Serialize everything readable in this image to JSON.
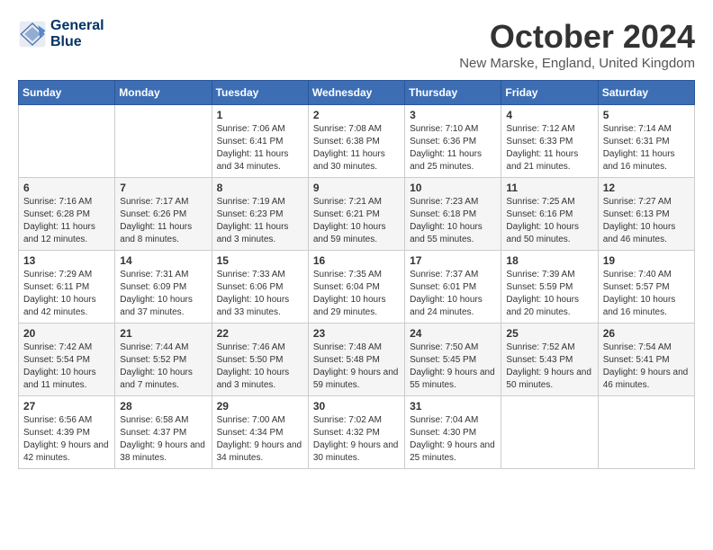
{
  "header": {
    "logo_line1": "General",
    "logo_line2": "Blue",
    "month_title": "October 2024",
    "location": "New Marske, England, United Kingdom"
  },
  "days_of_week": [
    "Sunday",
    "Monday",
    "Tuesday",
    "Wednesday",
    "Thursday",
    "Friday",
    "Saturday"
  ],
  "weeks": [
    [
      {
        "day": "",
        "sunrise": "",
        "sunset": "",
        "daylight": ""
      },
      {
        "day": "",
        "sunrise": "",
        "sunset": "",
        "daylight": ""
      },
      {
        "day": "1",
        "sunrise": "Sunrise: 7:06 AM",
        "sunset": "Sunset: 6:41 PM",
        "daylight": "Daylight: 11 hours and 34 minutes."
      },
      {
        "day": "2",
        "sunrise": "Sunrise: 7:08 AM",
        "sunset": "Sunset: 6:38 PM",
        "daylight": "Daylight: 11 hours and 30 minutes."
      },
      {
        "day": "3",
        "sunrise": "Sunrise: 7:10 AM",
        "sunset": "Sunset: 6:36 PM",
        "daylight": "Daylight: 11 hours and 25 minutes."
      },
      {
        "day": "4",
        "sunrise": "Sunrise: 7:12 AM",
        "sunset": "Sunset: 6:33 PM",
        "daylight": "Daylight: 11 hours and 21 minutes."
      },
      {
        "day": "5",
        "sunrise": "Sunrise: 7:14 AM",
        "sunset": "Sunset: 6:31 PM",
        "daylight": "Daylight: 11 hours and 16 minutes."
      }
    ],
    [
      {
        "day": "6",
        "sunrise": "Sunrise: 7:16 AM",
        "sunset": "Sunset: 6:28 PM",
        "daylight": "Daylight: 11 hours and 12 minutes."
      },
      {
        "day": "7",
        "sunrise": "Sunrise: 7:17 AM",
        "sunset": "Sunset: 6:26 PM",
        "daylight": "Daylight: 11 hours and 8 minutes."
      },
      {
        "day": "8",
        "sunrise": "Sunrise: 7:19 AM",
        "sunset": "Sunset: 6:23 PM",
        "daylight": "Daylight: 11 hours and 3 minutes."
      },
      {
        "day": "9",
        "sunrise": "Sunrise: 7:21 AM",
        "sunset": "Sunset: 6:21 PM",
        "daylight": "Daylight: 10 hours and 59 minutes."
      },
      {
        "day": "10",
        "sunrise": "Sunrise: 7:23 AM",
        "sunset": "Sunset: 6:18 PM",
        "daylight": "Daylight: 10 hours and 55 minutes."
      },
      {
        "day": "11",
        "sunrise": "Sunrise: 7:25 AM",
        "sunset": "Sunset: 6:16 PM",
        "daylight": "Daylight: 10 hours and 50 minutes."
      },
      {
        "day": "12",
        "sunrise": "Sunrise: 7:27 AM",
        "sunset": "Sunset: 6:13 PM",
        "daylight": "Daylight: 10 hours and 46 minutes."
      }
    ],
    [
      {
        "day": "13",
        "sunrise": "Sunrise: 7:29 AM",
        "sunset": "Sunset: 6:11 PM",
        "daylight": "Daylight: 10 hours and 42 minutes."
      },
      {
        "day": "14",
        "sunrise": "Sunrise: 7:31 AM",
        "sunset": "Sunset: 6:09 PM",
        "daylight": "Daylight: 10 hours and 37 minutes."
      },
      {
        "day": "15",
        "sunrise": "Sunrise: 7:33 AM",
        "sunset": "Sunset: 6:06 PM",
        "daylight": "Daylight: 10 hours and 33 minutes."
      },
      {
        "day": "16",
        "sunrise": "Sunrise: 7:35 AM",
        "sunset": "Sunset: 6:04 PM",
        "daylight": "Daylight: 10 hours and 29 minutes."
      },
      {
        "day": "17",
        "sunrise": "Sunrise: 7:37 AM",
        "sunset": "Sunset: 6:01 PM",
        "daylight": "Daylight: 10 hours and 24 minutes."
      },
      {
        "day": "18",
        "sunrise": "Sunrise: 7:39 AM",
        "sunset": "Sunset: 5:59 PM",
        "daylight": "Daylight: 10 hours and 20 minutes."
      },
      {
        "day": "19",
        "sunrise": "Sunrise: 7:40 AM",
        "sunset": "Sunset: 5:57 PM",
        "daylight": "Daylight: 10 hours and 16 minutes."
      }
    ],
    [
      {
        "day": "20",
        "sunrise": "Sunrise: 7:42 AM",
        "sunset": "Sunset: 5:54 PM",
        "daylight": "Daylight: 10 hours and 11 minutes."
      },
      {
        "day": "21",
        "sunrise": "Sunrise: 7:44 AM",
        "sunset": "Sunset: 5:52 PM",
        "daylight": "Daylight: 10 hours and 7 minutes."
      },
      {
        "day": "22",
        "sunrise": "Sunrise: 7:46 AM",
        "sunset": "Sunset: 5:50 PM",
        "daylight": "Daylight: 10 hours and 3 minutes."
      },
      {
        "day": "23",
        "sunrise": "Sunrise: 7:48 AM",
        "sunset": "Sunset: 5:48 PM",
        "daylight": "Daylight: 9 hours and 59 minutes."
      },
      {
        "day": "24",
        "sunrise": "Sunrise: 7:50 AM",
        "sunset": "Sunset: 5:45 PM",
        "daylight": "Daylight: 9 hours and 55 minutes."
      },
      {
        "day": "25",
        "sunrise": "Sunrise: 7:52 AM",
        "sunset": "Sunset: 5:43 PM",
        "daylight": "Daylight: 9 hours and 50 minutes."
      },
      {
        "day": "26",
        "sunrise": "Sunrise: 7:54 AM",
        "sunset": "Sunset: 5:41 PM",
        "daylight": "Daylight: 9 hours and 46 minutes."
      }
    ],
    [
      {
        "day": "27",
        "sunrise": "Sunrise: 6:56 AM",
        "sunset": "Sunset: 4:39 PM",
        "daylight": "Daylight: 9 hours and 42 minutes."
      },
      {
        "day": "28",
        "sunrise": "Sunrise: 6:58 AM",
        "sunset": "Sunset: 4:37 PM",
        "daylight": "Daylight: 9 hours and 38 minutes."
      },
      {
        "day": "29",
        "sunrise": "Sunrise: 7:00 AM",
        "sunset": "Sunset: 4:34 PM",
        "daylight": "Daylight: 9 hours and 34 minutes."
      },
      {
        "day": "30",
        "sunrise": "Sunrise: 7:02 AM",
        "sunset": "Sunset: 4:32 PM",
        "daylight": "Daylight: 9 hours and 30 minutes."
      },
      {
        "day": "31",
        "sunrise": "Sunrise: 7:04 AM",
        "sunset": "Sunset: 4:30 PM",
        "daylight": "Daylight: 9 hours and 25 minutes."
      },
      {
        "day": "",
        "sunrise": "",
        "sunset": "",
        "daylight": ""
      },
      {
        "day": "",
        "sunrise": "",
        "sunset": "",
        "daylight": ""
      }
    ]
  ]
}
